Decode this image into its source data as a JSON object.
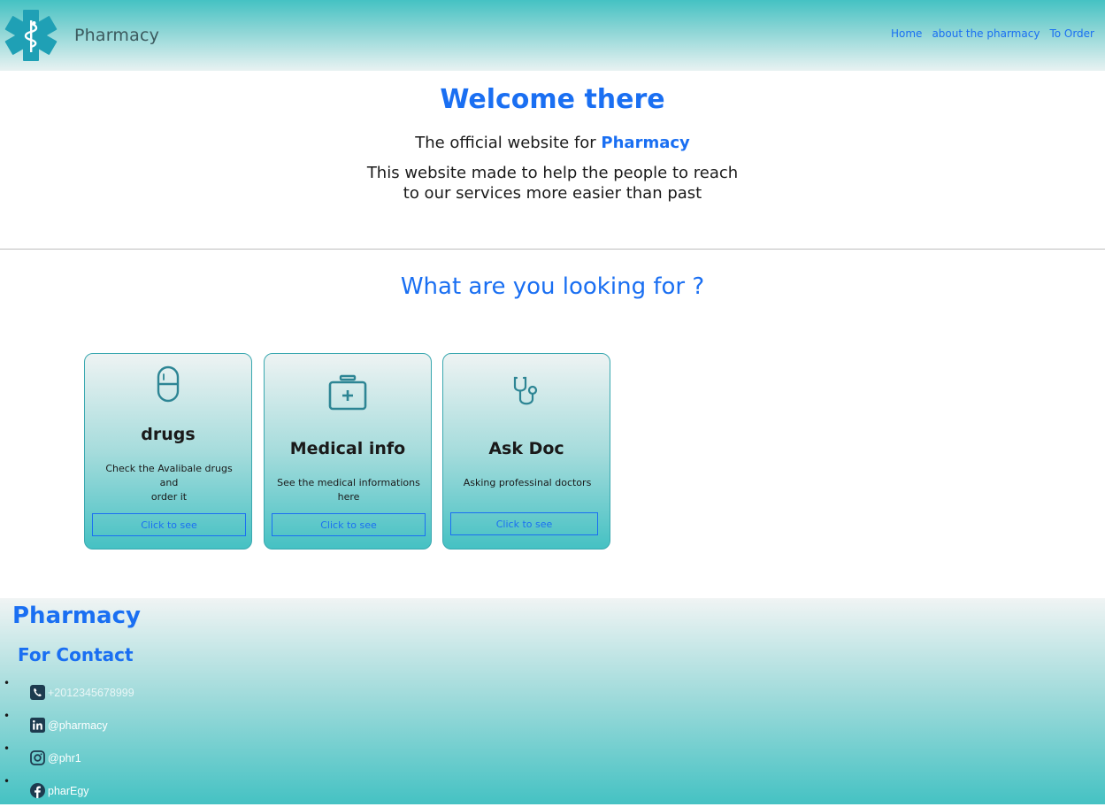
{
  "header": {
    "brand": "Pharmacy",
    "nav": [
      {
        "label": "Home"
      },
      {
        "label": "about the pharmacy"
      },
      {
        "label": "To Order"
      }
    ]
  },
  "welcome": {
    "title": "Welcome there",
    "line1_prefix": "The official website for ",
    "line1_highlight": "Pharmacy",
    "line2a": "This website made to help the people to reach",
    "line2b": "to our services more easier than past"
  },
  "section": {
    "title": "What are you looking for ?"
  },
  "cards": [
    {
      "icon": "pill-capsule-icon",
      "title": "drugs",
      "desc_a": "Check the Avalibale drugs and",
      "desc_b": "order it",
      "button": "Click to see"
    },
    {
      "icon": "first-aid-kit-icon",
      "title": "Medical info",
      "desc_a": "See the medical informations",
      "desc_b": "here",
      "button": "Click to see"
    },
    {
      "icon": "stethoscope-icon",
      "title": "Ask Doc",
      "desc_a": "Asking professinal doctors",
      "desc_b": "",
      "button": "Click to see"
    }
  ],
  "footer": {
    "brand": "Pharmacy",
    "contact_title": "For Contact",
    "contacts": [
      {
        "icon": "phone-icon",
        "text": "+2012345678999"
      },
      {
        "icon": "linkedin-icon",
        "text": "@pharmacy"
      },
      {
        "icon": "instagram-icon",
        "text": "@phr1"
      },
      {
        "icon": "facebook-icon",
        "text": "pharEgy"
      }
    ]
  },
  "colors": {
    "accent": "#1a6ff2",
    "teal": "#45c2c3",
    "icon_teal": "#2d8594"
  }
}
